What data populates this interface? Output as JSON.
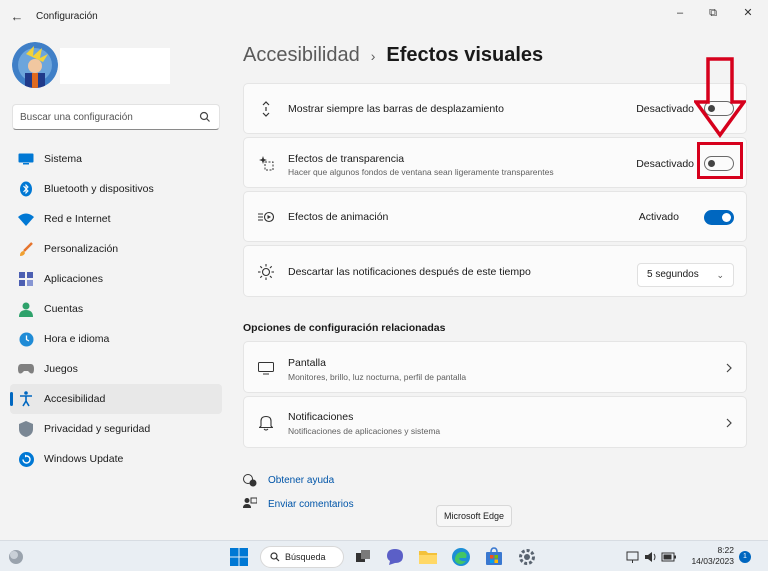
{
  "window": {
    "title": "Configuración",
    "back_icon": "back-arrow-icon",
    "minimize": "–",
    "maximize": "⧉",
    "close": "✕"
  },
  "sidebar": {
    "search_placeholder": "Buscar una configuración",
    "items": [
      {
        "label": "Sistema",
        "icon": "monitor-icon"
      },
      {
        "label": "Bluetooth y dispositivos",
        "icon": "bluetooth-icon"
      },
      {
        "label": "Red e Internet",
        "icon": "wifi-icon"
      },
      {
        "label": "Personalización",
        "icon": "brush-icon"
      },
      {
        "label": "Aplicaciones",
        "icon": "apps-icon"
      },
      {
        "label": "Cuentas",
        "icon": "person-icon"
      },
      {
        "label": "Hora e idioma",
        "icon": "globe-clock-icon"
      },
      {
        "label": "Juegos",
        "icon": "gamepad-icon"
      },
      {
        "label": "Accesibilidad",
        "icon": "accessibility-icon",
        "active": true
      },
      {
        "label": "Privacidad y seguridad",
        "icon": "shield-icon"
      },
      {
        "label": "Windows Update",
        "icon": "update-icon"
      }
    ]
  },
  "breadcrumb": {
    "parent": "Accesibilidad",
    "separator": "›",
    "current": "Efectos visuales"
  },
  "settings": [
    {
      "label": "Mostrar siempre las barras de desplazamiento",
      "state": "Desactivado",
      "on": false,
      "icon": "scrollbar-icon"
    },
    {
      "label": "Efectos de transparencia",
      "sub": "Hacer que algunos fondos de ventana sean ligeramente transparentes",
      "state": "Desactivado",
      "on": false,
      "icon": "transparency-icon"
    },
    {
      "label": "Efectos de animación",
      "state": "Activado",
      "on": true,
      "icon": "animation-icon"
    },
    {
      "label": "Descartar las notificaciones después de este tiempo",
      "value": "5 segundos",
      "icon": "sun-icon"
    }
  ],
  "related": {
    "title": "Opciones de configuración relacionadas",
    "items": [
      {
        "label": "Pantalla",
        "sub": "Monitores, brillo, luz nocturna, perfil de pantalla",
        "icon": "display-icon"
      },
      {
        "label": "Notificaciones",
        "sub": "Notificaciones de aplicaciones y sistema",
        "icon": "bell-icon"
      }
    ]
  },
  "links": {
    "help": "Obtener ayuda",
    "feedback": "Enviar comentarios"
  },
  "tooltip": "Microsoft Edge",
  "taskbar": {
    "search_label": "Búsqueda",
    "time": "8:22",
    "date": "14/03/2023",
    "notification_count": "1"
  },
  "colors": {
    "accent": "#0067c0",
    "annotation": "#d6001c",
    "background": "#f3f3f3"
  }
}
